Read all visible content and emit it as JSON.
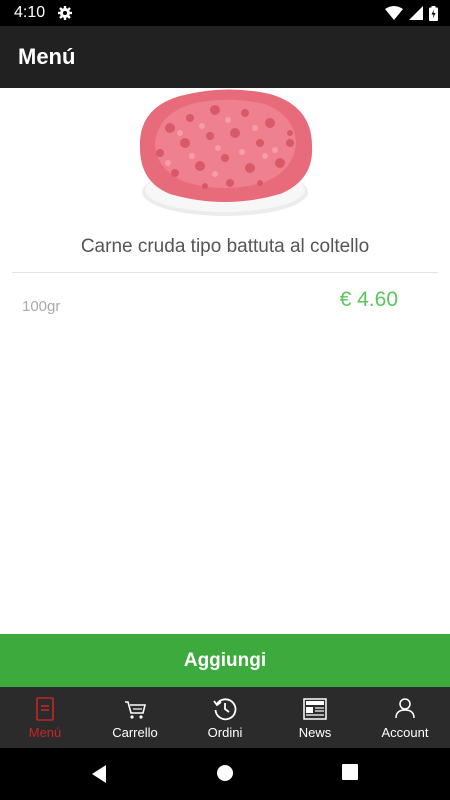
{
  "status_bar": {
    "time": "4:10"
  },
  "app_bar": {
    "title": "Menú"
  },
  "product": {
    "image_icon": "ground-beef-image",
    "name": "Carne cruda tipo battuta al coltello",
    "weight": "100gr",
    "price": "€ 4.60"
  },
  "actions": {
    "add_label": "Aggiungi"
  },
  "bottom_nav": {
    "items": [
      {
        "label": "Menú",
        "icon": "menu-icon",
        "active": true
      },
      {
        "label": "Carrello",
        "icon": "cart-icon",
        "active": false
      },
      {
        "label": "Ordini",
        "icon": "history-icon",
        "active": false
      },
      {
        "label": "News",
        "icon": "newspaper-icon",
        "active": false
      },
      {
        "label": "Account",
        "icon": "person-icon",
        "active": false
      }
    ]
  },
  "colors": {
    "app_bar": "#212121",
    "accent_green": "#3caa3c",
    "price_green": "#5cc45c",
    "active_nav": "#c0282a",
    "nav_bg": "#2b2b2b"
  }
}
